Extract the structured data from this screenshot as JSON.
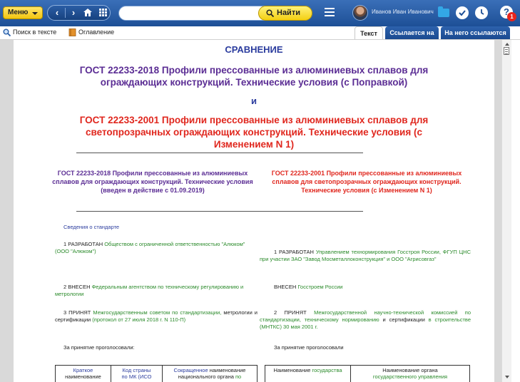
{
  "topbar": {
    "menu_label": "Меню",
    "search_placeholder": "",
    "find_label": "Найти",
    "user_name": "Иванов Иван Иванович",
    "help_badge": "1"
  },
  "toolbar": {
    "search_in_text": "Поиск в тексте",
    "contents": "Оглавление",
    "tabs": [
      {
        "label": "Текст",
        "active": true
      },
      {
        "label": "Ссылается на",
        "active": false
      },
      {
        "label": "На него ссылаются",
        "active": false
      }
    ]
  },
  "document": {
    "heading": "СРАВНЕНИЕ",
    "new_title": "ГОСТ 22233-2018 Профили прессованные из алюминиевых сплавов для ограждающих конструкций. Технические условия (с Поправкой)",
    "and": "и",
    "old_title": "ГОСТ 22233-2001 Профили прессованные из алюминиевых сплавов для светопрозрачных ограждающих конструкций. Технические условия (с Изменением N 1)",
    "left_col": {
      "title": "ГОСТ 22233-2018 Профили прессованные из алюминиевых сплавов для ограждающих конструкций. Технические условия",
      "effective": "(введен в действие с 01.09.2019)",
      "info_heading": "Сведения о стандарте",
      "p1_prefix": "1 РАЗРАБОТАН ",
      "p1_link": "Обществом с ограниченной ответственностью \"Алюком\" (ООО \"Алюком\")",
      "p2_prefix": "2 ВНЕСЕН ",
      "p2_link": "Федеральным агентством по техническому регулированию и метрологии",
      "p3_prefix": "3 ПРИНЯТ ",
      "p3_link1": "Межгосударственным советом по стандартизации,",
      "p3_mid": " метрологии и сертификации ",
      "p3_link2": "(протокол от 27 июля 2018 г. N 110-П)",
      "voted": "За принятие проголосовали:",
      "table_headers": [
        [
          "Краткое",
          "наименование"
        ],
        [
          "Код страны",
          "по МК (ИСО"
        ],
        [
          "Сокращенное ",
          "наименование",
          "национального органа ",
          "по"
        ]
      ]
    },
    "right_col": {
      "title": "ГОСТ 22233-2001 Профили прессованные из алюминиевых сплавов для светопрозрачных ограждающих конструкций. Технические условия (с Изменением N 1)",
      "p1_prefix": "1 РАЗРАБОТАН ",
      "p1_link": "Управлением технормирования Госстроя России, ФГУП ЦНС при участии ЗАО \"Завод Мосметаллоконструкция\" и ООО \"Агрисовгаз\"",
      "p2_prefix": "ВНЕСЕН ",
      "p2_link": "Госстроем России",
      "p3_prefix": "2 ПРИНЯТ ",
      "p3_link": "Межгосударственной научно-технической комиссией по стандартизации, техническому нормированию",
      "p3_mid": " и сертификации ",
      "p3_link2": "в строительстве (МНТКС) 30 мая 2001 г.",
      "voted": "За принятие проголосовали",
      "table_headers": [
        [
          "Наименование ",
          "государства"
        ],
        [
          "Наименование органа",
          "государственного управления"
        ]
      ]
    }
  }
}
